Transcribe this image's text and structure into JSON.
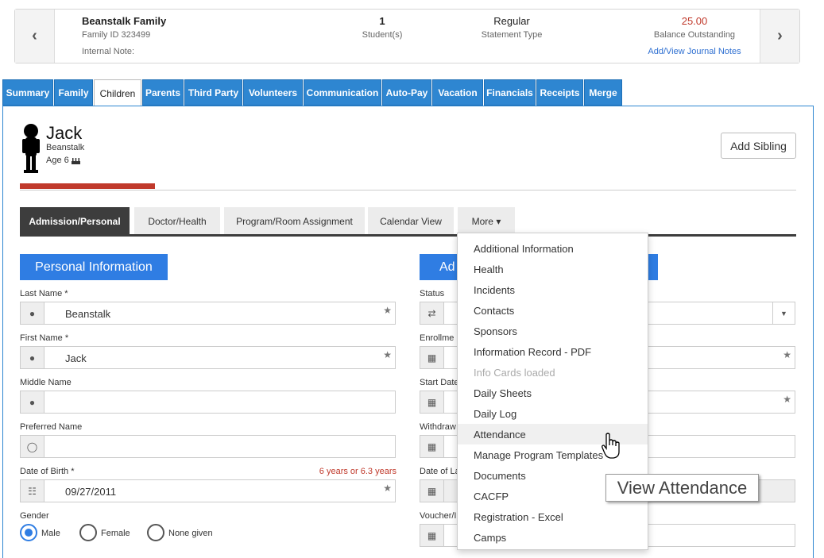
{
  "family": {
    "name": "Beanstalk Family",
    "id_label": "Family ID 323499",
    "internal_note": "Internal Note:",
    "students_count": "1",
    "students_label": "Student(s)",
    "statement_type": "Regular",
    "statement_label": "Statement Type",
    "balance": "25.00",
    "balance_label": "Balance Outstanding",
    "journal_link": "Add/View Journal Notes",
    "prev_glyph": "‹",
    "next_glyph": "›"
  },
  "tabs": [
    "Summary",
    "Family",
    "Children",
    "Parents",
    "Third Party",
    "Volunteers",
    "Communication",
    "Auto-Pay",
    "Vacation",
    "Financials",
    "Receipts",
    "Merge"
  ],
  "active_tab": "Children",
  "child": {
    "first_name": "Jack",
    "last_name": "Beanstalk",
    "age": "Age 6",
    "add_sibling": "Add Sibling"
  },
  "subtabs": [
    "Admission/Personal",
    "Doctor/Health",
    "Program/Room Assignment",
    "Calendar View",
    "More ▾"
  ],
  "personal": {
    "heading": "Personal Information",
    "fields": [
      {
        "label": "Last Name *",
        "value": "Beanstalk"
      },
      {
        "label": "First Name *",
        "value": "Jack"
      },
      {
        "label": "Middle Name",
        "value": ""
      },
      {
        "label": "Preferred Name",
        "value": ""
      },
      {
        "label": "Date of Birth *",
        "value": "09/27/2011",
        "note": "6 years or 6.3 years"
      }
    ],
    "gender_label": "Gender",
    "gender_options": [
      "Male",
      "Female",
      "None given"
    ],
    "gender_selected": "Male"
  },
  "admission": {
    "heading": "Ad",
    "labels": [
      "Status",
      "Enrollme",
      "Start Date",
      "Withdraw",
      "Date of La",
      "Voucher/I"
    ]
  },
  "more_menu": {
    "items": [
      "Additional Information",
      "Health",
      "Incidents",
      "Contacts",
      "Sponsors",
      "Information Record - PDF",
      "Info Cards loaded",
      "Daily Sheets",
      "Daily Log",
      "Attendance",
      "Manage Program Templates",
      "Documents",
      "CACFP",
      "Registration - Excel",
      "Camps"
    ],
    "disabled": "Info Cards loaded",
    "highlighted": "Attendance"
  },
  "tooltip": "View Attendance",
  "colors": {
    "tab_blue": "#2e86d1",
    "section_blue": "#2f7de3",
    "balance_red": "#c0392b",
    "progress_red": "#c0392b"
  }
}
